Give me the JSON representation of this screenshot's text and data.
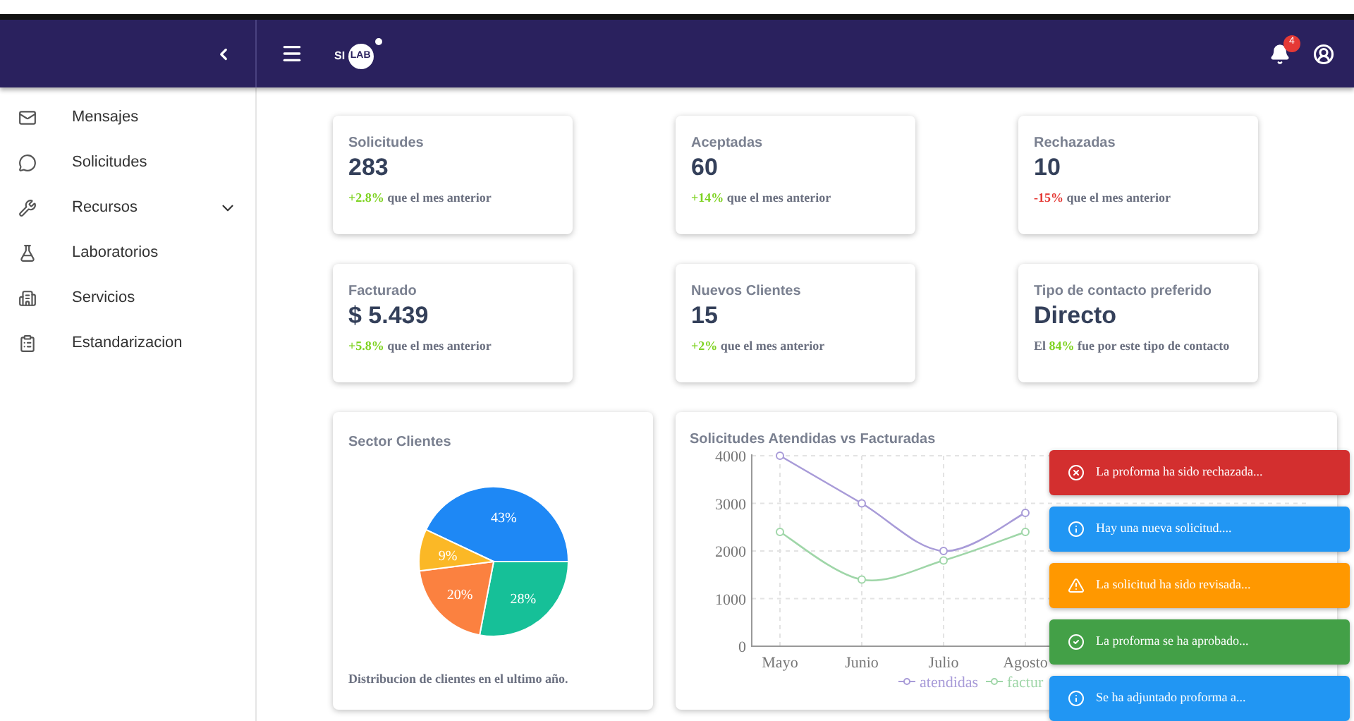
{
  "header": {
    "logo": {
      "left": "SI",
      "right": "LAB"
    },
    "notifications": {
      "count": "4"
    }
  },
  "sidebar": {
    "items": [
      {
        "label": "Mensajes",
        "expandable": false
      },
      {
        "label": "Solicitudes",
        "expandable": false
      },
      {
        "label": "Recursos",
        "expandable": true
      },
      {
        "label": "Laboratorios",
        "expandable": false
      },
      {
        "label": "Servicios",
        "expandable": false
      },
      {
        "label": "Estandarizacion",
        "expandable": false
      }
    ]
  },
  "stats": [
    {
      "title": "Solicitudes",
      "value": "283",
      "change": "+2.8%",
      "suffix": "que el mes anterior",
      "color": "#7ed321"
    },
    {
      "title": "Aceptadas",
      "value": "60",
      "change": "+14%",
      "suffix": "que el mes anterior",
      "color": "#7ed321"
    },
    {
      "title": "Rechazadas",
      "value": "10",
      "change": "-15%",
      "suffix": "que el mes anterior",
      "color": "#e53935"
    },
    {
      "title": "Facturado",
      "value": "$ 5.439",
      "change": "+5.8%",
      "suffix": "que el mes anterior",
      "color": "#7ed321"
    },
    {
      "title": "Nuevos Clientes",
      "value": "15",
      "change": "+2%",
      "suffix": "que el mes anterior",
      "color": "#7ed321"
    },
    {
      "title": "Tipo de contacto preferido",
      "value": "Directo",
      "prefix": "El",
      "change": "84%",
      "suffix": "fue por este tipo de contacto",
      "color": "#7ed321"
    }
  ],
  "sector_card": {
    "title": "Sector Clientes",
    "caption": "Distribucion de clientes en el ultimo año.",
    "chart_data": {
      "type": "pie",
      "values": [
        43,
        28,
        20,
        9
      ],
      "value_labels": [
        "43%",
        "28%",
        "20%",
        "9%"
      ]
    }
  },
  "line_card": {
    "title": "Solicitudes Atendidas vs Facturadas",
    "chart_data": {
      "type": "line",
      "categories": [
        "Mayo",
        "Junio",
        "Julio",
        "Agosto"
      ],
      "ylim": [
        0,
        4000
      ],
      "yticks": [
        0,
        1000,
        2000,
        3000,
        4000
      ],
      "grid": true,
      "legend": true,
      "series": [
        {
          "name": "atendidas",
          "color": "#a89bd8",
          "marker": "circle",
          "values": [
            4000,
            3000,
            2000,
            2800
          ]
        },
        {
          "name": "factur",
          "color": "#9fd6a8",
          "marker": "circle",
          "values": [
            2400,
            1400,
            1800,
            2400
          ]
        }
      ]
    }
  },
  "toasts": [
    {
      "kind": "error",
      "message": "La proforma ha sido rechazada..."
    },
    {
      "kind": "info",
      "message": "Hay una nueva solicitud...."
    },
    {
      "kind": "warning",
      "message": "La solicitud ha sido revisada..."
    },
    {
      "kind": "success",
      "message": "La proforma se ha aprobado..."
    },
    {
      "kind": "info",
      "message": "Se ha adjuntado proforma a..."
    }
  ]
}
